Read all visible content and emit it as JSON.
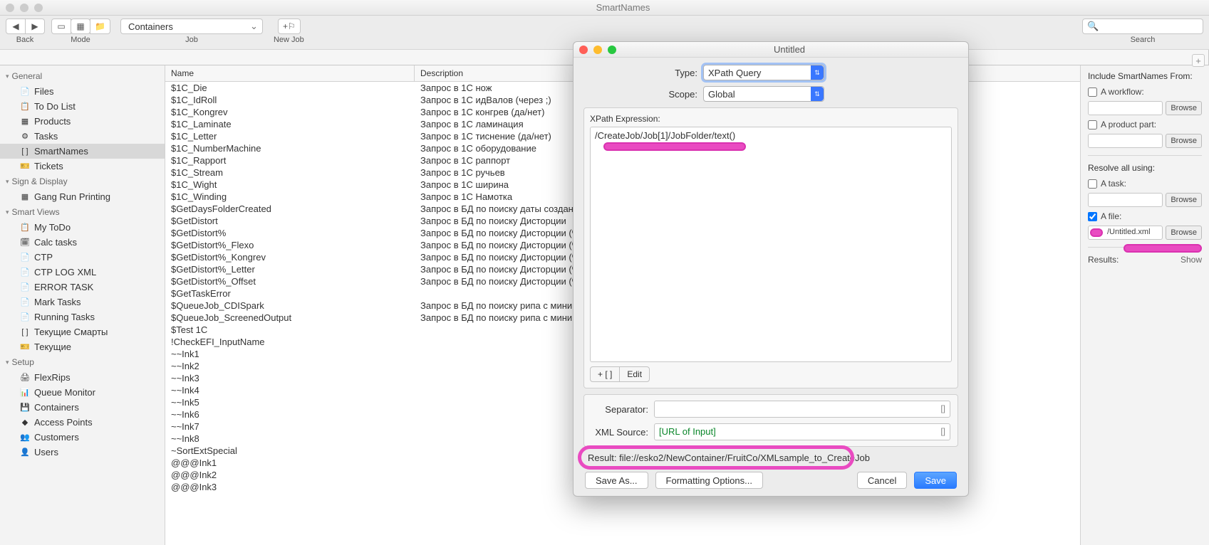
{
  "window": {
    "title": "SmartNames"
  },
  "toolbar": {
    "back_label": "Back",
    "mode_label": "Mode",
    "job_combo": "Containers",
    "job_label": "Job",
    "newjob_icon": "+⚐",
    "newjob_label": "New Job",
    "search_label": "Search",
    "search_icon": "🔍"
  },
  "tabs": {
    "main": "SmartNames",
    "plus": "+"
  },
  "sidebar": {
    "groups": [
      {
        "title": "General",
        "items": [
          {
            "icon": "📄",
            "label": "Files"
          },
          {
            "icon": "📋",
            "label": "To Do List"
          },
          {
            "icon": "▦",
            "label": "Products"
          },
          {
            "icon": "⚙",
            "label": "Tasks"
          },
          {
            "icon": "[ ]",
            "label": "SmartNames",
            "sel": true
          },
          {
            "icon": "🎫",
            "label": "Tickets"
          }
        ]
      },
      {
        "title": "Sign & Display",
        "items": [
          {
            "icon": "▦",
            "label": "Gang Run Printing"
          }
        ]
      },
      {
        "title": "Smart Views",
        "items": [
          {
            "icon": "📋",
            "label": "My ToDo"
          },
          {
            "icon": "🗓",
            "label": "Calc tasks"
          },
          {
            "icon": "📄",
            "label": "CTP"
          },
          {
            "icon": "📄",
            "label": "CTP LOG XML"
          },
          {
            "icon": "📄",
            "label": "ERROR TASK"
          },
          {
            "icon": "📄",
            "label": "Mark Tasks"
          },
          {
            "icon": "📄",
            "label": "Running Tasks"
          },
          {
            "icon": "[ ]",
            "label": "Текущие Смарты"
          },
          {
            "icon": "🎫",
            "label": "Текущие"
          }
        ]
      },
      {
        "title": "Setup",
        "items": [
          {
            "icon": "🖨",
            "label": "FlexRips"
          },
          {
            "icon": "📊",
            "label": "Queue Monitor"
          },
          {
            "icon": "💾",
            "label": "Containers"
          },
          {
            "icon": "◆",
            "label": "Access Points"
          },
          {
            "icon": "👥",
            "label": "Customers"
          },
          {
            "icon": "👤",
            "label": "Users"
          }
        ]
      }
    ]
  },
  "list": {
    "headers": {
      "name": "Name",
      "desc": "Description"
    },
    "rows": [
      {
        "n": "$1C_Die",
        "d": "Запрос в 1С нож"
      },
      {
        "n": "$1C_IdRoll",
        "d": "Запрос в 1С идВалов (через ;)"
      },
      {
        "n": "$1C_Kongrev",
        "d": "Запрос в 1С конгрев (да/нет)"
      },
      {
        "n": "$1C_Laminate",
        "d": "Запрос в 1С ламинация"
      },
      {
        "n": "$1C_Letter",
        "d": "Запрос в 1С тиснение (да/нет)"
      },
      {
        "n": "$1C_NumberMachine",
        "d": "Запрос в 1С оборудование"
      },
      {
        "n": "$1C_Rapport",
        "d": "Запрос в 1С раппорт"
      },
      {
        "n": "$1C_Stream",
        "d": "Запрос в 1С ручьев"
      },
      {
        "n": "$1C_Wight",
        "d": "Запрос в 1С ширина"
      },
      {
        "n": "$1C_Winding",
        "d": "Запрос в 1С Намотка"
      },
      {
        "n": "$GetDaysFolderCreated",
        "d": "Запрос в БД по поиску даты создания"
      },
      {
        "n": "$GetDistort",
        "d": "Запрос в БД по поиску Дисторции"
      },
      {
        "n": "$GetDistort%",
        "d": "Запрос в БД по поиску Дисторции (%)"
      },
      {
        "n": "$GetDistort%_Flexo",
        "d": "Запрос в БД по поиску Дисторции (%)"
      },
      {
        "n": "$GetDistort%_Kongrev",
        "d": "Запрос в БД по поиску Дисторции (%)"
      },
      {
        "n": "$GetDistort%_Letter",
        "d": "Запрос в БД по поиску Дисторции (%)"
      },
      {
        "n": "$GetDistort%_Offset",
        "d": "Запрос в БД по поиску Дисторции (%)"
      },
      {
        "n": "$GetTaskError",
        "d": ""
      },
      {
        "n": "$QueueJob_CDISpark",
        "d": "Запрос в БД по поиску рипа с минима…"
      },
      {
        "n": "$QueueJob_ScreenedOutput",
        "d": "Запрос в БД по поиску рипа с минима…"
      },
      {
        "n": "$Test 1C",
        "d": ""
      },
      {
        "n": "!CheckEFI_InputName",
        "d": ""
      },
      {
        "n": "~~Ink1",
        "d": ""
      },
      {
        "n": "~~Ink2",
        "d": ""
      },
      {
        "n": "~~Ink3",
        "d": ""
      },
      {
        "n": "~~Ink4",
        "d": ""
      },
      {
        "n": "~~Ink5",
        "d": ""
      },
      {
        "n": "~~Ink6",
        "d": ""
      },
      {
        "n": "~~Ink7",
        "d": ""
      },
      {
        "n": "~~Ink8",
        "d": ""
      },
      {
        "n": "~SortExtSpecial",
        "d": ""
      },
      {
        "n": "@@@Ink1",
        "d": ""
      },
      {
        "n": "@@@Ink2",
        "d": ""
      },
      {
        "n": "@@@Ink3",
        "d": ""
      }
    ]
  },
  "right": {
    "include_header": "Include SmartNames From:",
    "workflow": "A workflow:",
    "productpart": "A product part:",
    "browse": "Browse",
    "resolve_header": "Resolve all using:",
    "task": "A task:",
    "file": "A file:",
    "file_path": "/Untitled.xml",
    "results": "Results:",
    "show": "Show"
  },
  "dialog": {
    "title": "Untitled",
    "type_label": "Type:",
    "type_value": "XPath Query",
    "scope_label": "Scope:",
    "scope_value": "Global",
    "xpath_label": "XPath Expression:",
    "xpath_value": "/CreateJob/Job[1]/JobFolder/text()",
    "insert_btn": "+ [ ]",
    "edit_btn": "Edit",
    "separator_label": "Separator:",
    "xmlsource_label": "XML Source:",
    "xmlsource_value": "[URL of Input]",
    "result_label": "Result:",
    "result_value": "file://esko2/NewContainer/FruitCo/XMLsample_to_CreateJob",
    "saveas": "Save As...",
    "format": "Formatting Options...",
    "cancel": "Cancel",
    "save": "Save"
  }
}
